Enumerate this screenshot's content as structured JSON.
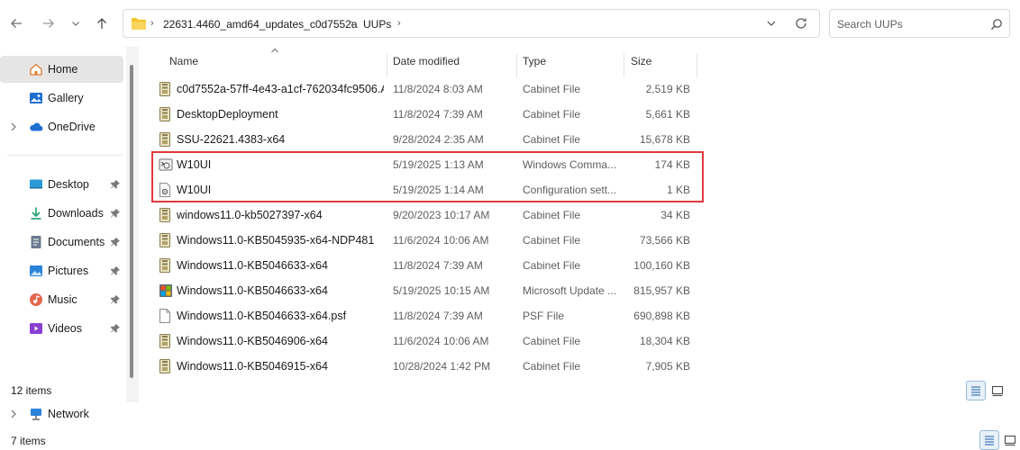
{
  "nav": {
    "back_icon": "arrow-left-icon",
    "forward_icon": "arrow-right-icon",
    "recent_icon": "chevron-down-icon",
    "up_icon": "arrow-up-icon"
  },
  "address": {
    "crumbs": [
      "22631.4460_amd64_updates_c0d7552a",
      "UUPs"
    ]
  },
  "search": {
    "placeholder": "Search UUPs"
  },
  "sidebar": {
    "items": [
      {
        "label": "Home",
        "icon": "home-icon",
        "selected": true
      },
      {
        "label": "Gallery",
        "icon": "gallery-icon"
      },
      {
        "label": "OneDrive",
        "icon": "cloud-icon"
      },
      {
        "label": "Desktop",
        "icon": "desktop-icon",
        "pinned": true
      },
      {
        "label": "Downloads",
        "icon": "download-icon",
        "pinned": true
      },
      {
        "label": "Documents",
        "icon": "documents-icon",
        "pinned": true
      },
      {
        "label": "Pictures",
        "icon": "pictures-icon",
        "pinned": true
      },
      {
        "label": "Music",
        "icon": "music-icon",
        "pinned": true
      },
      {
        "label": "Videos",
        "icon": "videos-icon",
        "pinned": true
      }
    ],
    "status_top": "12 items",
    "network_label": "Network",
    "status_bottom": "7 items"
  },
  "columns": {
    "name": "Name",
    "date": "Date modified",
    "type": "Type",
    "size": "Size"
  },
  "files": [
    {
      "name": "c0d7552a-57ff-4e43-a1cf-762034fc9506.A...",
      "date": "11/8/2024 8:03 AM",
      "type": "Cabinet File",
      "size": "2,519 KB",
      "icon": "cabinet-file-icon"
    },
    {
      "name": "DesktopDeployment",
      "date": "11/8/2024 7:39 AM",
      "type": "Cabinet File",
      "size": "5,661 KB",
      "icon": "cabinet-file-icon"
    },
    {
      "name": "SSU-22621.4383-x64",
      "date": "9/28/2024 2:35 AM",
      "type": "Cabinet File",
      "size": "15,678 KB",
      "icon": "cabinet-file-icon"
    },
    {
      "name": "W10UI",
      "date": "5/19/2025 1:13 AM",
      "type": "Windows Comma...",
      "size": "174 KB",
      "icon": "batch-file-icon"
    },
    {
      "name": "W10UI",
      "date": "5/19/2025 1:14 AM",
      "type": "Configuration sett...",
      "size": "1 KB",
      "icon": "config-file-icon"
    },
    {
      "name": "windows11.0-kb5027397-x64",
      "date": "9/20/2023 10:17 AM",
      "type": "Cabinet File",
      "size": "34 KB",
      "icon": "cabinet-file-icon"
    },
    {
      "name": "Windows11.0-KB5045935-x64-NDP481",
      "date": "11/6/2024 10:06 AM",
      "type": "Cabinet File",
      "size": "73,566 KB",
      "icon": "cabinet-file-icon"
    },
    {
      "name": "Windows11.0-KB5046633-x64",
      "date": "11/8/2024 7:39 AM",
      "type": "Cabinet File",
      "size": "100,160 KB",
      "icon": "cabinet-file-icon"
    },
    {
      "name": "Windows11.0-KB5046633-x64",
      "date": "5/19/2025 10:15 AM",
      "type": "Microsoft Update ...",
      "size": "815,957 KB",
      "icon": "msu-file-icon"
    },
    {
      "name": "Windows11.0-KB5046633-x64.psf",
      "date": "11/8/2024 7:39 AM",
      "type": "PSF File",
      "size": "690,898 KB",
      "icon": "blank-file-icon"
    },
    {
      "name": "Windows11.0-KB5046906-x64",
      "date": "11/6/2024 10:06 AM",
      "type": "Cabinet File",
      "size": "18,304 KB",
      "icon": "cabinet-file-icon"
    },
    {
      "name": "Windows11.0-KB5046915-x64",
      "date": "10/28/2024 1:42 PM",
      "type": "Cabinet File",
      "size": "7,905 KB",
      "icon": "cabinet-file-icon"
    }
  ],
  "colors": {
    "highlight": "#e0393d",
    "selected_nav": "#e5e5e5",
    "folder": "#f4c42b"
  }
}
